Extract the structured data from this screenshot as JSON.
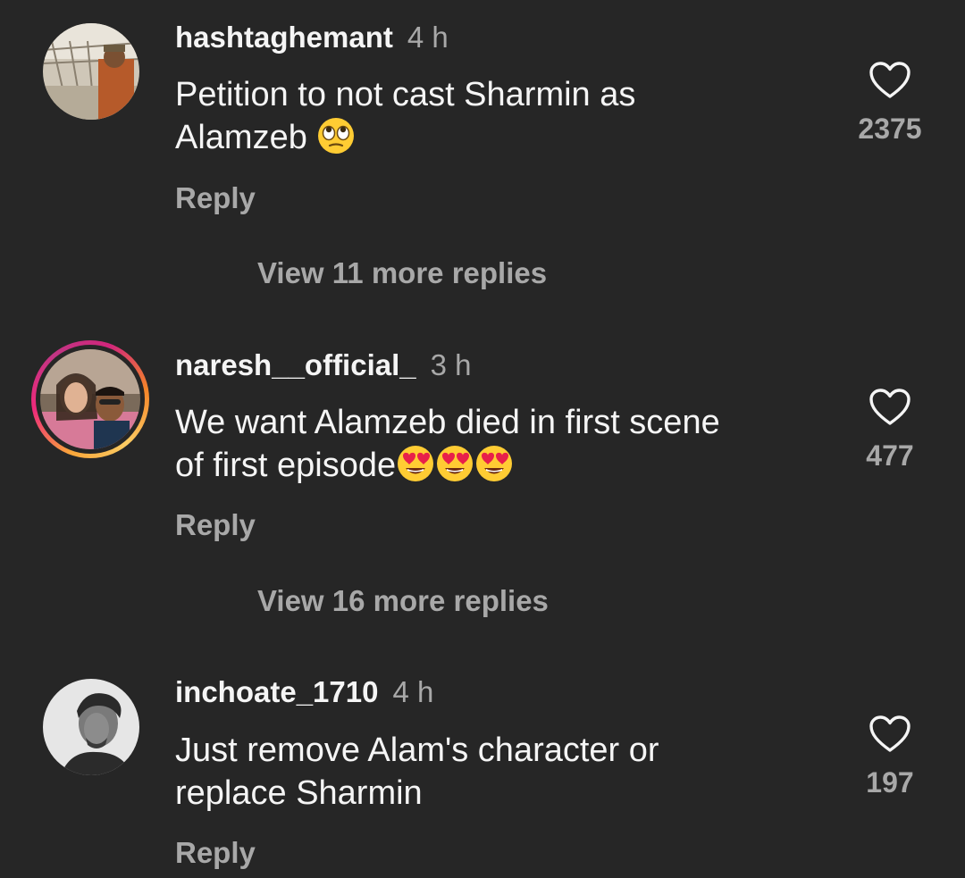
{
  "comments": [
    {
      "username": "hashtaghemant",
      "time": "4 h",
      "text": "Petition to not cast Sharmin as Alamzeb",
      "text_line1": "Petition to not cast Sharmin as",
      "text_line2": "Alamzeb",
      "emoji": "face-with-rolling-eyes",
      "likes": "2375",
      "reply_label": "Reply",
      "view_replies": "View 11 more replies"
    },
    {
      "username": "naresh__official_",
      "time": "3 h",
      "text_line1": "We want Alamzeb died in first scene",
      "text_line2": "of first episode",
      "emoji": "smiling-face-with-heart-eyes",
      "likes": "477",
      "reply_label": "Reply",
      "view_replies": "View 16 more replies"
    },
    {
      "username": "inchoate_1710",
      "time": "4 h",
      "text_line1": "Just remove Alam's character or",
      "text_line2": "replace Sharmin",
      "likes": "197",
      "reply_label": "Reply"
    }
  ],
  "colors": {
    "background": "#262626",
    "primary_text": "#f5f5f5",
    "secondary_text": "#a8a8a8",
    "story_ring": "#ee2a7b"
  },
  "icons": {
    "like": "heart-outline-icon"
  }
}
